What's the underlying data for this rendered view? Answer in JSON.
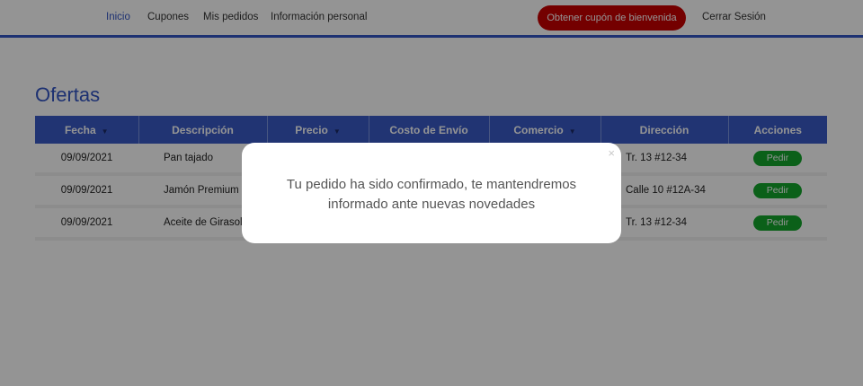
{
  "nav": {
    "links": [
      "Inicio",
      "Cupones",
      "Mis pedidos",
      "Información personal"
    ],
    "cta_label": "Obtener cupón de bienvenida",
    "logout_label": "Cerrar Sesión"
  },
  "main": {
    "title": "Ofertas",
    "table": {
      "headers": [
        "Fecha",
        "Descripción",
        "Precio",
        "Costo de Envío",
        "Comercio",
        "Dirección",
        "Acciones"
      ],
      "sortable": [
        "Fecha",
        "Precio",
        "Comercio"
      ],
      "sort_icon": "triangle-down",
      "rows": [
        {
          "fecha": "09/09/2021",
          "descripcion": "Pan tajado",
          "precio": "",
          "costo_envio": "",
          "comercio": "",
          "direccion": "Tr. 13 #12-34",
          "accion": "Pedir"
        },
        {
          "fecha": "09/09/2021",
          "descripcion": "Jamón Premium",
          "precio": "",
          "costo_envio": "",
          "comercio": "",
          "direccion": "Calle 10 #12A-34",
          "accion": "Pedir"
        },
        {
          "fecha": "09/09/2021",
          "descripcion": "Aceite de Girasol",
          "precio": "",
          "costo_envio": "",
          "comercio": "",
          "direccion": "Tr. 13 #12-34",
          "accion": "Pedir"
        }
      ]
    }
  },
  "modal": {
    "close_icon": "×",
    "message": "Tu pedido ha sido confirmado, te mantendremos informado ante nuevas novedades"
  },
  "colors": {
    "accent": "#3355c4",
    "cta": "#c90000",
    "order_button": "#13a52b"
  }
}
